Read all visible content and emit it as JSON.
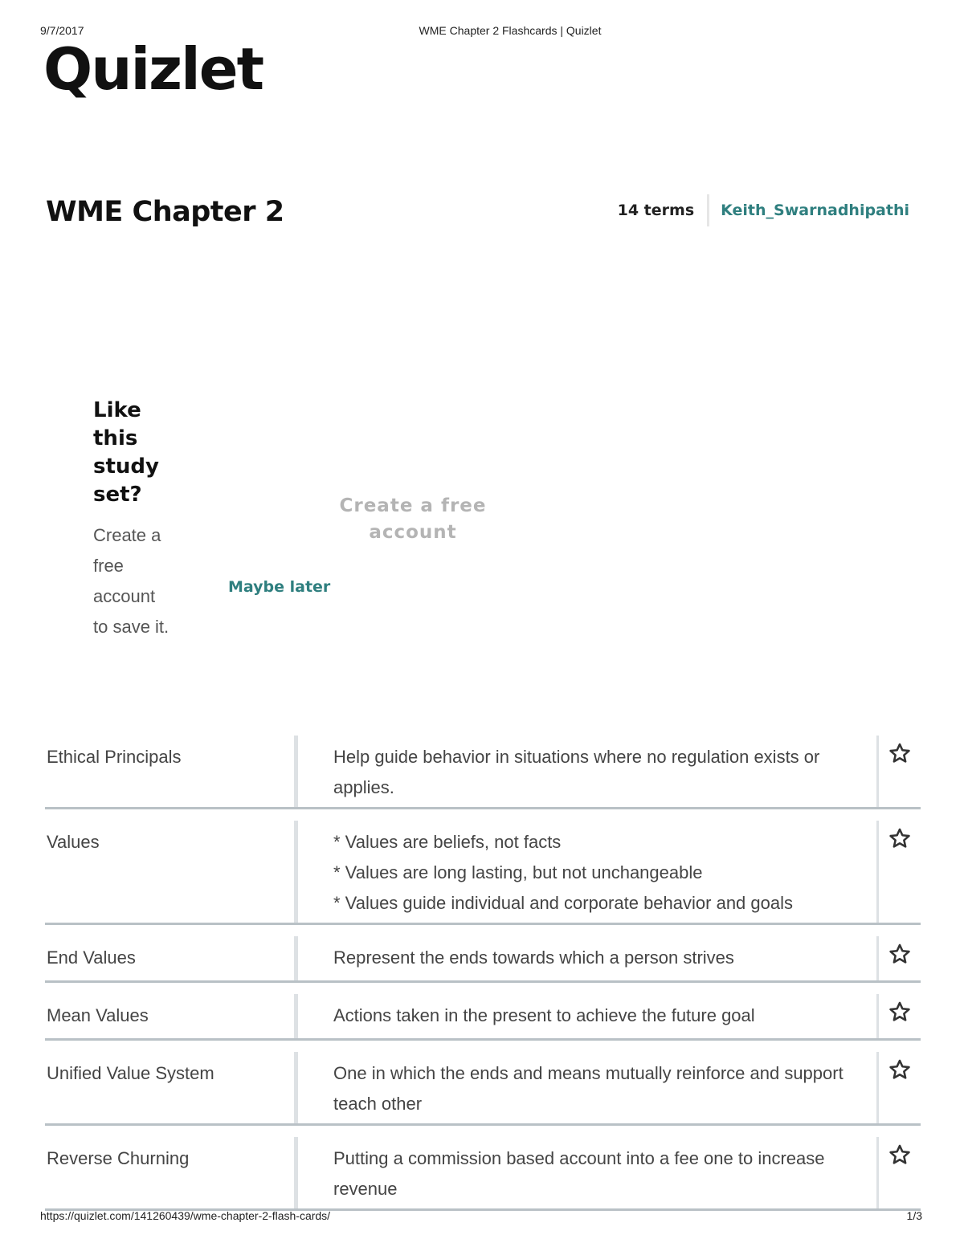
{
  "print_header": {
    "date": "9/7/2017",
    "title": "WME Chapter 2 Flashcards | Quizlet"
  },
  "logo": "Quizlet",
  "set": {
    "title": "WME Chapter 2",
    "terms_count": "14 terms",
    "author": "Keith_Swarnadhipathi"
  },
  "promo": {
    "heading": "Like this study set?",
    "subtext": "Create a free account to save it.",
    "maybe_later": "Maybe later",
    "create_account": "Create a free account"
  },
  "terms": [
    {
      "term": "Ethical Principals",
      "definition": [
        "Help guide behavior in situations where no regulation exists or applies."
      ]
    },
    {
      "term": "Values",
      "definition": [
        "* Values are beliefs, not facts",
        "* Values are long lasting, but not unchangeable",
        "* Values guide individual and corporate behavior and goals"
      ]
    },
    {
      "term": "End Values",
      "definition": [
        "Represent the ends towards which a person strives"
      ]
    },
    {
      "term": "Mean Values",
      "definition": [
        "Actions taken in the present to achieve the future goal"
      ]
    },
    {
      "term": "Unified Value System",
      "definition": [
        "One in which the ends and means mutually reinforce and support teach other"
      ]
    },
    {
      "term": "Reverse Churning",
      "definition": [
        "Putting a commission based account into a fee one to increase revenue"
      ]
    }
  ],
  "print_footer": {
    "url": "https://quizlet.com/141260439/wme-chapter-2-flash-cards/",
    "page": "1/3"
  },
  "icons": {
    "star": "star-outline-icon"
  },
  "colors": {
    "accent": "#2f7f7f",
    "divider": "#b9c1c6",
    "button_text": "#b4b4b4"
  }
}
